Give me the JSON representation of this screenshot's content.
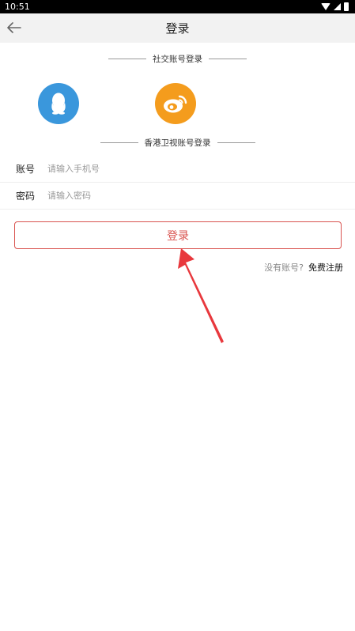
{
  "status_bar": {
    "time": "10:51"
  },
  "nav": {
    "title": "登录"
  },
  "social": {
    "section_title": "社交账号登录"
  },
  "account": {
    "section_title": "香港卫视账号登录"
  },
  "form": {
    "account_label": "账号",
    "account_placeholder": "请输入手机号",
    "password_label": "密码",
    "password_placeholder": "请输入密码"
  },
  "actions": {
    "login_label": "登录",
    "no_account_text": "没有账号?",
    "register_label": "免费注册"
  },
  "colors": {
    "qq": "#3a97dc",
    "weibo": "#f49c1d",
    "accent": "#d9534f",
    "arrow": "#e8383d"
  }
}
